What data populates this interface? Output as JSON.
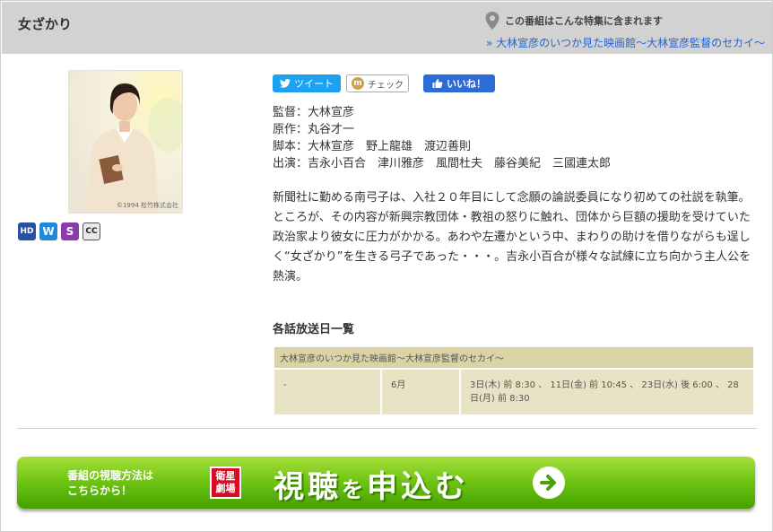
{
  "program": {
    "title": "女ざかり"
  },
  "feature": {
    "caption": "この番組はこんな特集に含まれます",
    "link_text": "» 大林宣彦のいつか見た映画館～大林宣彦監督のセカイ～",
    "icon": "map-pin-icon"
  },
  "poster": {
    "copyright": "©1994 松竹株式会社"
  },
  "badges": [
    "HD",
    "W",
    "S",
    "CC"
  ],
  "social": {
    "tweet_label": "ツイート",
    "check_label": "チェック",
    "check_icon_letter": "m",
    "like_label": "いいね！"
  },
  "credits": [
    "監督：大林宣彦",
    "原作：丸谷才一",
    "脚本：大林宣彦　野上龍雄　渡辺善則",
    "出演：吉永小百合　津川雅彦　風間杜夫　藤谷美紀　三國連太郎"
  ],
  "synopsis": "新聞社に勤める南弓子は、入社２０年目にして念願の論説委員になり初めての社説を執筆。ところが、その内容が新興宗教団体・教祖の怒りに触れ、団体から巨額の援助を受けていた政治家より彼女に圧力がかかる。あわや左遷かという中、まわりの助けを借りながらも逞しく“女ざかり”を生きる弓子であった・・・。吉永小百合が様々な試練に立ち向かう主人公を熱演。",
  "schedule": {
    "heading": "各話放送日一覧",
    "table_caption": "大林宣彦のいつか見た映画館～大林宣彦監督のセカイ～",
    "rows": [
      {
        "episode": "-",
        "month": "6月",
        "dates": "3日(木) 前 8:30 、 11日(金) 前 10:45 、 23日(水) 後 6:00 、 28日(月) 前 8:30"
      }
    ]
  },
  "apply_banner": {
    "left_line1": "番組の視聴方法は",
    "left_line2": "こちらから！",
    "logo_line1": "衛星",
    "logo_line2": "劇場",
    "main_part1": "視聴",
    "main_part2": "を",
    "main_part3": "申込む"
  },
  "colors": {
    "header_bg": "#d2d2d2",
    "link": "#2a63c9",
    "tweet": "#1da1f2",
    "like": "#2d6bd6",
    "table_bg": "#e8e3c4",
    "banner_green": "#6cc312",
    "logo_red": "#d80c24"
  }
}
